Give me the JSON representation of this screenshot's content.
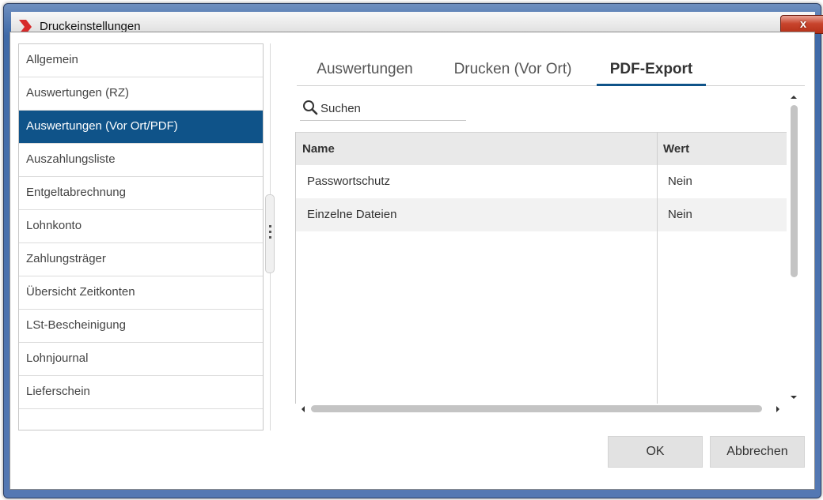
{
  "window": {
    "title": "Druckeinstellungen",
    "close_label": "x",
    "accent_color": "#0f5389",
    "logo_color": "#d72b2b"
  },
  "sidebar": {
    "items": [
      {
        "label": "Allgemein",
        "selected": false
      },
      {
        "label": "Auswertungen (RZ)",
        "selected": false
      },
      {
        "label": "Auswertungen (Vor Ort/PDF)",
        "selected": true
      },
      {
        "label": "Auszahlungsliste",
        "selected": false
      },
      {
        "label": "Entgeltabrechnung",
        "selected": false
      },
      {
        "label": "Lohnkonto",
        "selected": false
      },
      {
        "label": "Zahlungsträger",
        "selected": false
      },
      {
        "label": "Übersicht Zeitkonten",
        "selected": false
      },
      {
        "label": "LSt-Bescheinigung",
        "selected": false
      },
      {
        "label": "Lohnjournal",
        "selected": false
      },
      {
        "label": "Lieferschein",
        "selected": false
      }
    ]
  },
  "tabs": [
    {
      "label": "Auswertungen",
      "active": false
    },
    {
      "label": "Drucken (Vor Ort)",
      "active": false
    },
    {
      "label": "PDF-Export",
      "active": true
    }
  ],
  "search": {
    "placeholder": "Suchen",
    "icon": "magnifier-icon"
  },
  "grid": {
    "columns": [
      "Name",
      "Wert"
    ],
    "rows": [
      [
        "Passwortschutz",
        "Nein"
      ],
      [
        "Einzelne Dateien",
        "Nein"
      ]
    ]
  },
  "footer": {
    "ok_label": "OK",
    "cancel_label": "Abbrechen"
  }
}
